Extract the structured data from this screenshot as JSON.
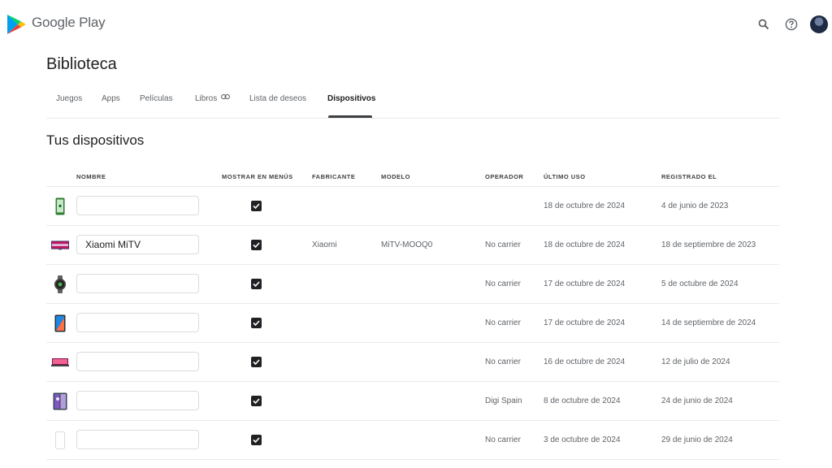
{
  "header": {
    "brand": "Google Play",
    "search_icon": "search-icon",
    "help_icon": "help-icon",
    "avatar_icon": "account-avatar"
  },
  "page_title": "Biblioteca",
  "tabs": [
    {
      "label": "Juegos"
    },
    {
      "label": "Apps"
    },
    {
      "label": "Películas"
    },
    {
      "label": "Libros",
      "icon": "link-icon"
    },
    {
      "label": "Lista de deseos"
    },
    {
      "label": "Dispositivos",
      "active": true
    }
  ],
  "section_title": "Tus dispositivos",
  "table": {
    "headers": [
      "NOMBRE",
      "MOSTRAR EN MENÚS",
      "FABRICANTE",
      "MODELO",
      "OPERADOR",
      "ÚLTIMO USO",
      "REGISTRADO EL"
    ],
    "rows": [
      {
        "icon": "android-phone-icon",
        "name": "",
        "show_in_menus": true,
        "manufacturer": "",
        "model": "",
        "carrier": "",
        "last_used": "18 de octubre de 2024",
        "registered": "4 de junio de 2023"
      },
      {
        "icon": "tv-icon",
        "name": "Xiaomi MiTV",
        "show_in_menus": true,
        "manufacturer": "Xiaomi",
        "model": "MiTV-MOOQ0",
        "carrier": "No carrier",
        "last_used": "18 de octubre de 2024",
        "registered": "18 de septiembre de 2023"
      },
      {
        "icon": "smartwatch-icon",
        "name": "",
        "show_in_menus": true,
        "manufacturer": "",
        "model": "",
        "carrier": "No carrier",
        "last_used": "17 de octubre de 2024",
        "registered": "5 de octubre de 2024"
      },
      {
        "icon": "tablet-icon",
        "name": "",
        "show_in_menus": true,
        "manufacturer": "",
        "model": "",
        "carrier": "No carrier",
        "last_used": "17 de octubre de 2024",
        "registered": "14 de septiembre de 2024"
      },
      {
        "icon": "laptop-icon",
        "name": "",
        "show_in_menus": true,
        "manufacturer": "",
        "model": "",
        "carrier": "No carrier",
        "last_used": "16 de octubre de 2024",
        "registered": "12 de julio de 2024"
      },
      {
        "icon": "foldable-phone-icon",
        "name": "",
        "show_in_menus": true,
        "manufacturer": "",
        "model": "",
        "carrier": "Digi Spain",
        "last_used": "8 de octubre de 2024",
        "registered": "24 de junio de 2024"
      },
      {
        "icon": "generic-phone-icon",
        "name": "",
        "show_in_menus": true,
        "manufacturer": "",
        "model": "",
        "carrier": "No carrier",
        "last_used": "3 de octubre de 2024",
        "registered": "29 de junio de 2024"
      }
    ]
  },
  "colors": {
    "accent": "#202124",
    "divider": "#e8eaed",
    "muted_text": "#5f6368"
  }
}
